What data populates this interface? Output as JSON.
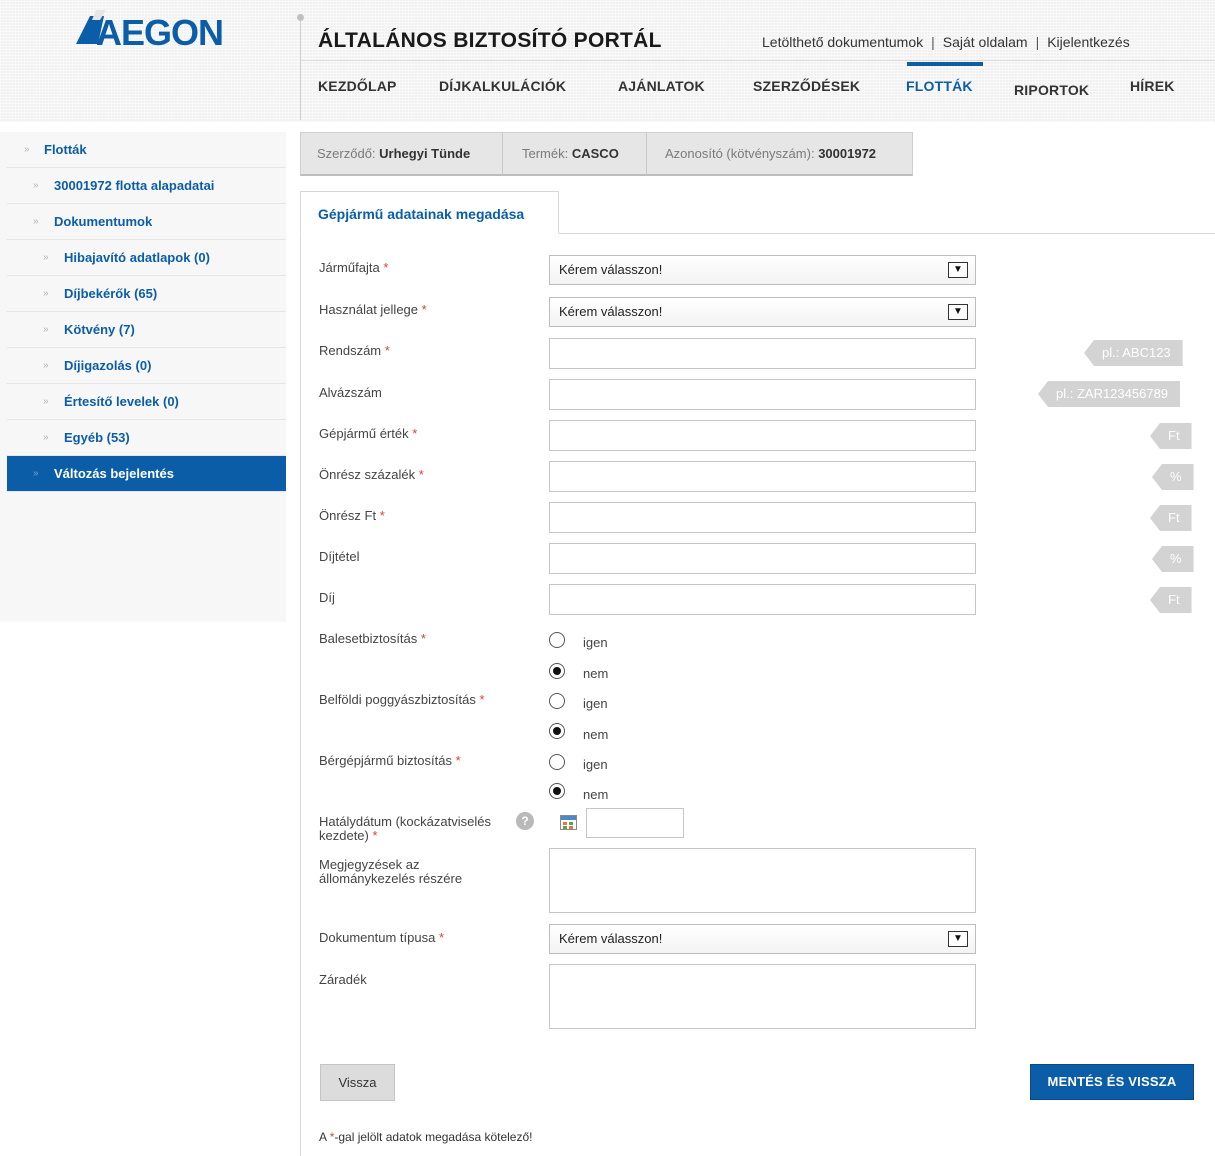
{
  "header": {
    "logo_text": "AEGON",
    "portal_title": "ÁLTALÁNOS BIZTOSÍTÓ PORTÁL",
    "top_links": [
      "Letölthető dokumentumok",
      "Saját oldalam",
      "Kijelentkezés"
    ],
    "nav": [
      "KEZDŐLAP",
      "DÍJKALKULÁCIÓK",
      "AJÁNLATOK",
      "SZERZŐDÉSEK",
      "FLOTTÁK",
      "RIPORTOK",
      "HÍREK"
    ],
    "active_nav": "FLOTTÁK"
  },
  "sidebar": {
    "items": [
      {
        "label": "Flották"
      },
      {
        "label": "30001972 flotta alapadatai"
      },
      {
        "label": "Dokumentumok"
      },
      {
        "label": "Hibajavító adatlapok (0)"
      },
      {
        "label": "Díjbekérők (65)"
      },
      {
        "label": "Kötvény (7)"
      },
      {
        "label": "Díjigazolás (0)"
      },
      {
        "label": "Értesítő levelek (0)"
      },
      {
        "label": "Egyéb (53)"
      },
      {
        "label": "Változás bejelentés"
      }
    ],
    "bullet": "»"
  },
  "infobar": {
    "contractor_label": "Szerződő:",
    "contractor_value": "Urhegyi Tünde",
    "product_label": "Termék:",
    "product_value": "CASCO",
    "id_label": "Azonosító (kötvényszám):",
    "id_value": "30001972"
  },
  "tab": {
    "label": "Gépjármű adatainak megadása"
  },
  "form": {
    "required_mark": "*",
    "vehicle_type": {
      "label": "Járműfajta",
      "value": "Kérem válasszon!"
    },
    "usage": {
      "label": "Használat jellege",
      "value": "Kérem válasszon!"
    },
    "plate": {
      "label": "Rendszám",
      "hint": "pl.: ABC123",
      "value": ""
    },
    "chassis": {
      "label": "Alvázszám",
      "hint": "pl.: ZAR123456789",
      "value": ""
    },
    "car_value": {
      "label": "Gépjármű érték",
      "hint": "Ft",
      "value": ""
    },
    "deductible_pct": {
      "label": "Önrész százalék",
      "hint": "%",
      "value": ""
    },
    "deductible_ft": {
      "label": "Önrész Ft",
      "hint": "Ft",
      "value": ""
    },
    "rate": {
      "label": "Díjtétel",
      "hint": "%",
      "value": ""
    },
    "fee": {
      "label": "Díj",
      "hint": "Ft",
      "value": ""
    },
    "accident": {
      "label": "Balesetbiztosítás",
      "options": [
        "igen",
        "nem"
      ],
      "selected": "nem"
    },
    "luggage": {
      "label": "Belföldi poggyászbiztosítás",
      "options": [
        "igen",
        "nem"
      ],
      "selected": "nem"
    },
    "rental": {
      "label": "Bérgépjármű biztosítás",
      "options": [
        "igen",
        "nem"
      ],
      "selected": "nem"
    },
    "effective_date": {
      "label_line1": "Hatálydátum (kockázatviselés",
      "label_line2": "kezdete)",
      "help": "?",
      "value": ""
    },
    "notes": {
      "label_line1": "Megjegyzések az",
      "label_line2": "állománykezelés részére",
      "value": ""
    },
    "doc_type": {
      "label": "Dokumentum típusa",
      "value": "Kérem válasszon!"
    },
    "clause": {
      "label": "Záradék",
      "value": ""
    }
  },
  "buttons": {
    "back": "Vissza",
    "save": "MENTÉS ÉS VISSZA"
  },
  "footnote": {
    "prefix": "A ",
    "star": "*",
    "suffix": "-gal jelölt adatok megadása kötelező!"
  },
  "colors": {
    "brand": "#0b5da8",
    "required": "#d9413b",
    "hint_bg": "#d3d3d3"
  }
}
